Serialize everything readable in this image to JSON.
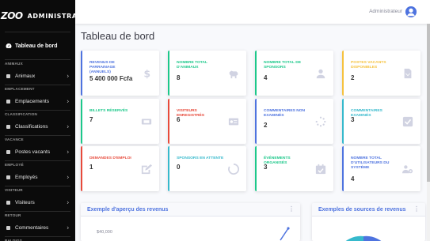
{
  "brand": {
    "logo": "ZOO",
    "title": "ADMINISTRATEU"
  },
  "sidebar": {
    "active": {
      "label": "Tableau de bord",
      "icon": "dashboard-icon"
    },
    "groups": [
      {
        "section": "ANIMAUX",
        "item": "Animaux",
        "icon": "paw-icon"
      },
      {
        "section": "EMPLACEMENT",
        "item": "Emplacements",
        "icon": "map-marker-icon"
      },
      {
        "section": "CLASSIFICATION",
        "item": "Classifications",
        "icon": "list-icon"
      },
      {
        "section": "VACANCE",
        "item": "Postes vacants",
        "icon": "briefcase-icon"
      },
      {
        "section": "EMPLOYÉ",
        "item": "Employés",
        "icon": "user-icon"
      },
      {
        "section": "VISITEUR",
        "item": "Visiteurs",
        "icon": "users-icon"
      },
      {
        "section": "RETOUR",
        "item": "Commentaires",
        "icon": "comment-icon"
      },
      {
        "section": "BALDIGS",
        "item": "",
        "icon": ""
      }
    ]
  },
  "topbar": {
    "user": "Administrateur"
  },
  "page": {
    "title": "Tableau de bord"
  },
  "cards": [
    {
      "label": "REVENUS DE PARRAINAGE (ANNUELS)",
      "value": "5 400 000 Fcfa",
      "color": "#4e73df",
      "icon": "dollar-icon"
    },
    {
      "label": "NOMBRE TOTAL D'ANIMAUX",
      "value": "8",
      "color": "#1cc88a",
      "icon": "dog-icon"
    },
    {
      "label": "NOMBRE TOTAL DE SPONSORS",
      "value": "4",
      "color": "#1cc88a",
      "icon": "user-tie-icon"
    },
    {
      "label": "POSTES VACANTS DISPONIBLES",
      "value": "2",
      "color": "#f6c23e",
      "icon": "file-icon"
    },
    {
      "label": "BILLETS RÉSERVÉS",
      "value": "7",
      "color": "#1cc88a",
      "icon": "ticket-icon"
    },
    {
      "label": "VISITEURS ENREGISTRÉS",
      "value": "6",
      "color": "#e74a3b",
      "icon": "id-card-icon"
    },
    {
      "label": "COMMENTAIRES NON EXAMINÉS",
      "value": "2",
      "color": "#4e73df",
      "icon": "spinner-icon"
    },
    {
      "label": "COMMENTAIRES EXAMINÉS",
      "value": "3",
      "color": "#36b9cc",
      "icon": "check-square-icon"
    },
    {
      "label": "DEMANDES D'EMPLOI",
      "value": "1",
      "color": "#e74a3b",
      "icon": "edit-icon"
    },
    {
      "label": "SPONSORS EN ATTENTE",
      "value": "0",
      "color": "#36b9cc",
      "icon": "circle-notch-icon"
    },
    {
      "label": "ÉVÉNEMENTS ORGANISÉS",
      "value": "3",
      "color": "#1cc88a",
      "icon": "calendar-check-icon"
    },
    {
      "label": "NOMBRE TOTAL D'UTILISATEURS DU SYSTÈME",
      "value": "4",
      "color": "#4e73df",
      "icon": "users-cog-icon"
    }
  ],
  "panels": {
    "revenue": {
      "title": "Exemple d'aperçu des revenus",
      "tick": "$40,000"
    },
    "sources": {
      "title": "Exemples de sources de revenus"
    }
  }
}
